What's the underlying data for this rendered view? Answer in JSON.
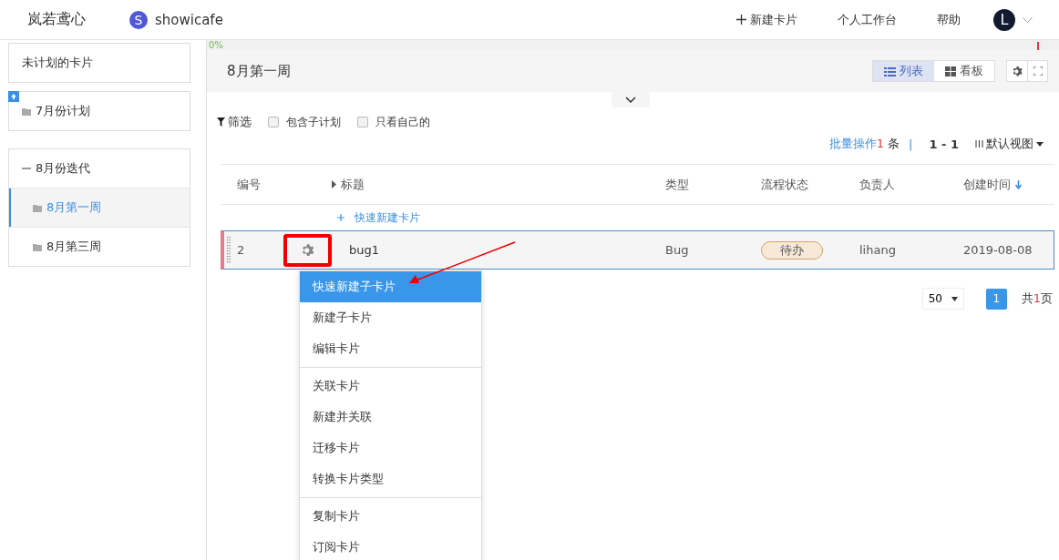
{
  "header": {
    "brand": "岚若鸢心",
    "logo_letter": "S",
    "product": "showicafe",
    "actions": [
      {
        "kind": "new",
        "label": "新建卡片"
      },
      {
        "kind": "plain",
        "label": "个人工作台"
      },
      {
        "kind": "plain",
        "label": "帮助"
      }
    ],
    "avatar_letter": "L"
  },
  "sidebar": {
    "items": [
      {
        "kind": "card",
        "label": "未计划的卡片",
        "marked": false
      },
      {
        "kind": "folder",
        "label": "7月份计划",
        "marked": true
      },
      {
        "kind": "group",
        "label": "8月份迭代",
        "expanded": true,
        "children": [
          {
            "label": "8月第一周",
            "selected": true
          },
          {
            "label": "8月第三周",
            "selected": false
          }
        ]
      }
    ]
  },
  "progress": {
    "label": "0%",
    "level": 0
  },
  "plan": {
    "title": "8月第一周",
    "expanded": false,
    "views": [
      {
        "kind": "list",
        "label": "列表",
        "selected": true
      },
      {
        "kind": "board",
        "label": "看板",
        "selected": false
      }
    ]
  },
  "filters": {
    "label": "筛选",
    "options": [
      {
        "label": "包含子计划",
        "checked": false
      },
      {
        "label": "只看自己的",
        "checked": false
      }
    ]
  },
  "batch": {
    "link": "批量操作",
    "count": "1",
    "unit": "条",
    "separator": "|",
    "range": "1 - 1",
    "view": "默认视图"
  },
  "table": {
    "columns": [
      {
        "label": "编号",
        "sorted": false
      },
      {
        "label": "标题",
        "sorted": false
      },
      {
        "label": "类型",
        "sorted": false
      },
      {
        "label": "流程状态",
        "sorted": false
      },
      {
        "label": "负责人",
        "sorted": false
      },
      {
        "label": "创建时间",
        "sorted": true
      }
    ],
    "quick_add": "快速新建卡片",
    "rows": [
      {
        "number": "2",
        "title": "bug1",
        "type": "Bug",
        "status": "待办",
        "owner": "lihang",
        "created": "2019-08-08",
        "selected": true,
        "gear_annotated": true
      }
    ]
  },
  "menu": {
    "groups": [
      [
        {
          "label": "快速新建子卡片",
          "selected": true
        },
        {
          "label": "新建子卡片",
          "selected": false
        },
        {
          "label": "编辑卡片",
          "selected": false
        }
      ],
      [
        {
          "label": "关联卡片",
          "selected": false
        },
        {
          "label": "新建并关联",
          "selected": false
        },
        {
          "label": "迁移卡片",
          "selected": false
        },
        {
          "label": "转换卡片类型",
          "selected": false
        }
      ],
      [
        {
          "label": "复制卡片",
          "selected": false
        },
        {
          "label": "订阅卡片",
          "selected": false
        }
      ]
    ]
  },
  "pagination": {
    "page_size": "50",
    "pages": [
      {
        "label": "1",
        "selected": true
      }
    ],
    "total_prefix": "共",
    "total_count": "1",
    "total_suffix": "页"
  }
}
